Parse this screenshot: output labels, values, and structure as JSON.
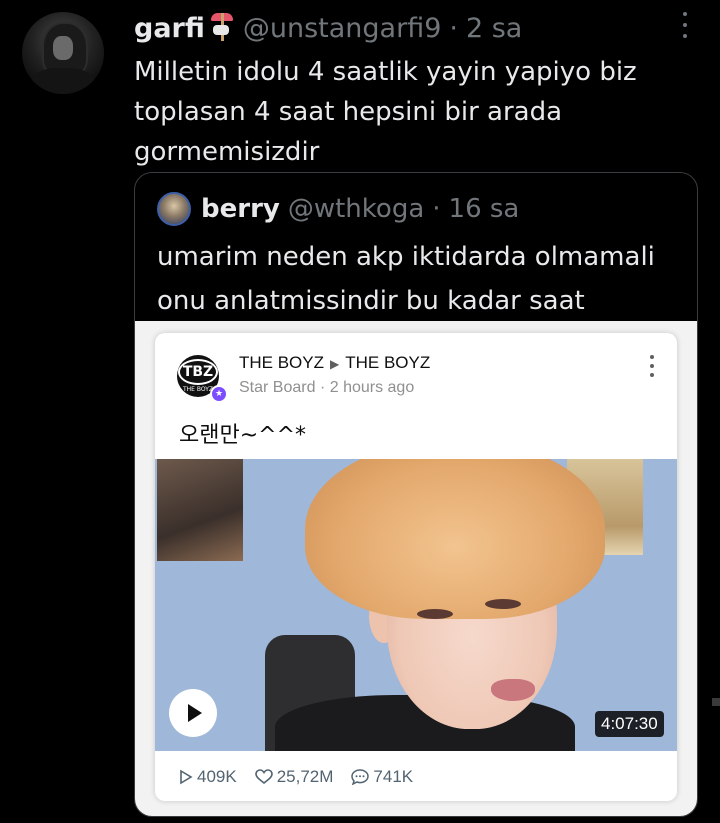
{
  "tweet": {
    "display_name": "garfi",
    "handle": "@unstangarfi9",
    "separator": "·",
    "time": "2 sa",
    "text": "Milletin idolu 4 saatlik yayin yapiyo biz\ntoplasan 4 saat hepsini bir arada\ngormemisizdir"
  },
  "quote": {
    "display_name": "berry",
    "handle": "@wthkoga",
    "separator": "·",
    "time": "16 sa",
    "text": "umarim neden akp iktidarda olmamali\nonu anlatmissindir bu kadar saat"
  },
  "youtube_card": {
    "logo_text": "TBZ",
    "logo_sub": "THE BOYZ",
    "badge": "★",
    "channel": "THE BOYZ",
    "arrow": "▶",
    "channel_target": "THE BOYZ",
    "board": "Star Board",
    "dot": "·",
    "posted": "2 hours ago",
    "post_text": "오랜만~^^*",
    "duration": "4:07:30"
  },
  "stats": {
    "views": "409K",
    "likes": "25,72M",
    "comments": "741K"
  },
  "colors": {
    "background": "#000000",
    "text_primary": "#e7e9ea",
    "text_secondary": "#71767b",
    "quote_border": "#3a3d40"
  }
}
